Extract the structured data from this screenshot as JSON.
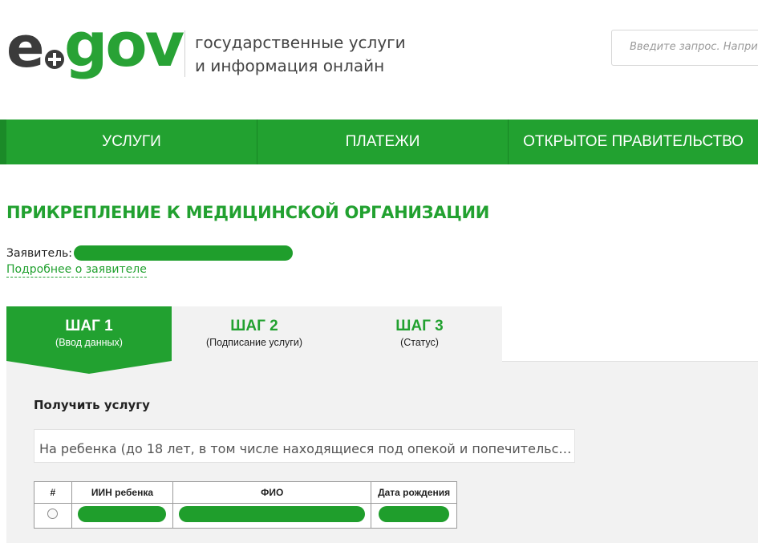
{
  "header": {
    "logo_e": "e",
    "logo_gov": "gov",
    "tagline_line1": "государственные услуги",
    "tagline_line2": "и информация онлайн",
    "search_placeholder": "Введите запрос. Например: Справка о несудимости"
  },
  "nav": {
    "items": [
      {
        "label": "УСЛУГИ"
      },
      {
        "label": "ПЛАТЕЖИ"
      },
      {
        "label": "ОТКРЫТОЕ ПРАВИТЕЛЬСТВО"
      }
    ]
  },
  "page": {
    "title": "ПРИКРЕПЛЕНИЕ К МЕДИЦИНСКОЙ ОРГАНИЗАЦИИ",
    "applicant_label": "Заявитель:",
    "more_link": "Подробнее о заявителе"
  },
  "steps": [
    {
      "title": "ШАГ 1",
      "subtitle": "(Ввод данных)",
      "active": true
    },
    {
      "title": "ШАГ 2",
      "subtitle": "(Подписание услуги)",
      "active": false
    },
    {
      "title": "ШАГ 3",
      "subtitle": "(Статус)",
      "active": false
    }
  ],
  "form": {
    "label": "Получить услугу",
    "select_value": "На ребенка (до 18 лет, в том числе находящиеся под опекой и попечительс…"
  },
  "table": {
    "headers": [
      "#",
      "ИИН ребенка",
      "ФИО",
      "Дата рождения"
    ]
  },
  "colors": {
    "brand_green": "#22a130",
    "logo_dark": "#3b3b3b",
    "panel_bg": "#f2f2f2"
  }
}
